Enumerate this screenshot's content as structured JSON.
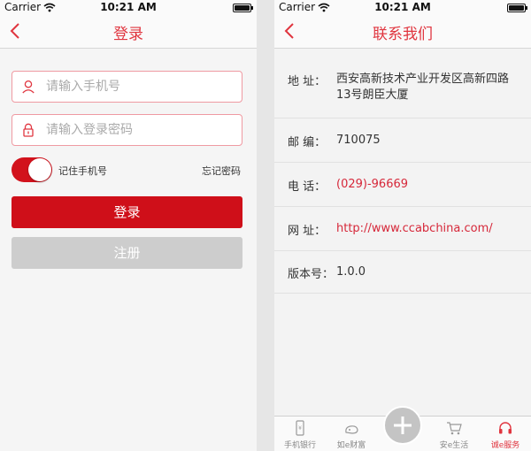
{
  "status_bar": {
    "carrier": "Carrier",
    "time": "10:21 AM"
  },
  "login_screen": {
    "title": "登录",
    "phone_placeholder": "请输入手机号",
    "password_placeholder": "请输入登录密码",
    "remember_label": "记住手机号",
    "remember_on": true,
    "forgot_label": "忘记密码",
    "login_label": "登录",
    "register_label": "注册"
  },
  "contact_screen": {
    "title": "联系我们",
    "address_label": "地  址：",
    "address_value": "西安高新技术产业开发区高新四路13号朗臣大厦",
    "zip_label": "邮  编：",
    "zip_value": "710075",
    "phone_label": "电  话：",
    "phone_value": "(029)-96669",
    "web_label": "网  址：",
    "web_value": "http://www.ccabchina.com/",
    "version_label": "版本号：",
    "version_value": "1.0.0"
  },
  "tab_bar": {
    "items": [
      "手机银行",
      "如e财富",
      "安e生活",
      "诚e服务"
    ],
    "active": "诚e服务"
  },
  "colors": {
    "accent": "#e0353f",
    "primary_button": "#cf0f19",
    "disabled_button": "#cdcdcd"
  }
}
